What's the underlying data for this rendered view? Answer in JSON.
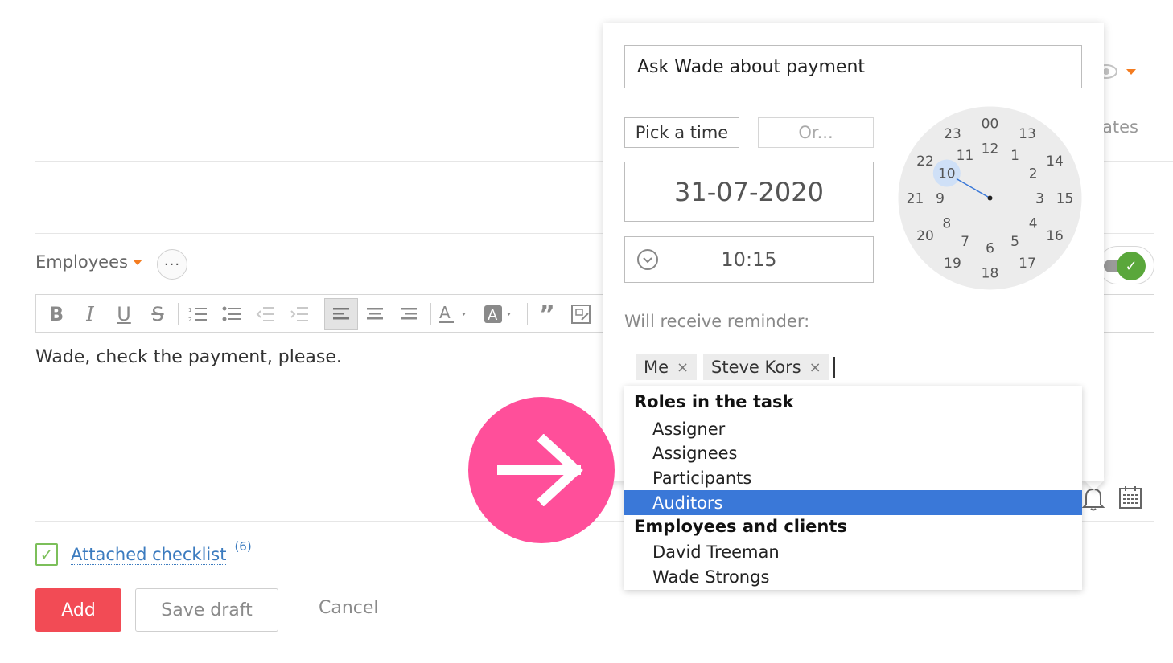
{
  "background": {
    "employees_label": "Employees",
    "more_label": "···",
    "editor_text": "Wade, check the payment, please.",
    "partial_label": "ates",
    "toolbar": {
      "bold": "B",
      "italic": "I",
      "underline": "U",
      "strike": "S",
      "quote": "”"
    },
    "checklist": {
      "label": "Attached checklist",
      "count": "(6)"
    },
    "buttons": {
      "add": "Add",
      "save_draft": "Save draft",
      "cancel": "Cancel"
    }
  },
  "popup": {
    "title_value": "Ask Wade about payment",
    "pick_time_label": "Pick a time",
    "or_label": "Or...",
    "date_value": "31-07-2020",
    "time_value": "10:15",
    "clock": {
      "outer": [
        "00",
        "13",
        "14",
        "15",
        "16",
        "17",
        "18",
        "19",
        "20",
        "21",
        "22",
        "23"
      ],
      "inner": [
        "12",
        "1",
        "2",
        "3",
        "4",
        "5",
        "6",
        "7",
        "8",
        "9",
        "10",
        "11"
      ],
      "selected_hour": "10"
    },
    "reminder_label": "Will receive reminder:",
    "recipients": [
      "Me",
      "Steve Kors"
    ],
    "remove_glyph": "×",
    "dropdown": {
      "group1": "Roles in the task",
      "group1_items": [
        "Assigner",
        "Assignees",
        "Participants",
        "Auditors"
      ],
      "group2": "Employees and clients",
      "group2_items": [
        "David Treeman",
        "Wade Strongs"
      ],
      "selected_item": "Auditors"
    }
  },
  "colors": {
    "accent_orange": "#f47c20",
    "add_button": "#f24b55",
    "selected_item": "#3a78d8",
    "callout_pink": "#ff4f9a",
    "toggle_green": "#5aa73b",
    "link_blue": "#3b7bbf"
  }
}
